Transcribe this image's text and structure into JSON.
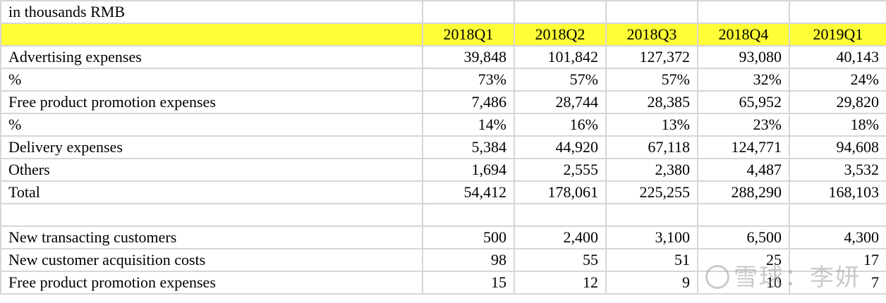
{
  "unit_label": "in thousands RMB",
  "columns": [
    "2018Q1",
    "2018Q2",
    "2018Q3",
    "2018Q4",
    "2019Q1"
  ],
  "rows": [
    {
      "label": "Advertising expenses",
      "values": [
        "39,848",
        "101,842",
        "127,372",
        "93,080",
        "40,143"
      ]
    },
    {
      "label": "%",
      "values": [
        "73%",
        "57%",
        "57%",
        "32%",
        "24%"
      ]
    },
    {
      "label": "Free product promotion expenses",
      "values": [
        "7,486",
        "28,744",
        "28,385",
        "65,952",
        "29,820"
      ]
    },
    {
      "label": "%",
      "values": [
        "14%",
        "16%",
        "13%",
        "23%",
        "18%"
      ]
    },
    {
      "label": "Delivery expenses",
      "values": [
        "5,384",
        "44,920",
        "67,118",
        "124,771",
        "94,608"
      ]
    },
    {
      "label": "Others",
      "values": [
        "1,694",
        "2,555",
        "2,380",
        "4,487",
        "3,532"
      ]
    },
    {
      "label": "Total",
      "values": [
        "54,412",
        "178,061",
        "225,255",
        "288,290",
        "168,103"
      ]
    }
  ],
  "rows2": [
    {
      "label": "New transacting customers",
      "values": [
        "500",
        "2,400",
        "3,100",
        "6,500",
        "4,300"
      ]
    },
    {
      "label": "New customer acquisition costs",
      "values": [
        "98",
        "55",
        "51",
        "25",
        "17"
      ]
    },
    {
      "label": "Free product promotion expenses",
      "values": [
        "15",
        "12",
        "9",
        "10",
        "7"
      ]
    }
  ],
  "watermark": "雪球：李妍",
  "colors": {
    "header_highlight": "#ffff37",
    "gridline": "#d6d6d6"
  }
}
